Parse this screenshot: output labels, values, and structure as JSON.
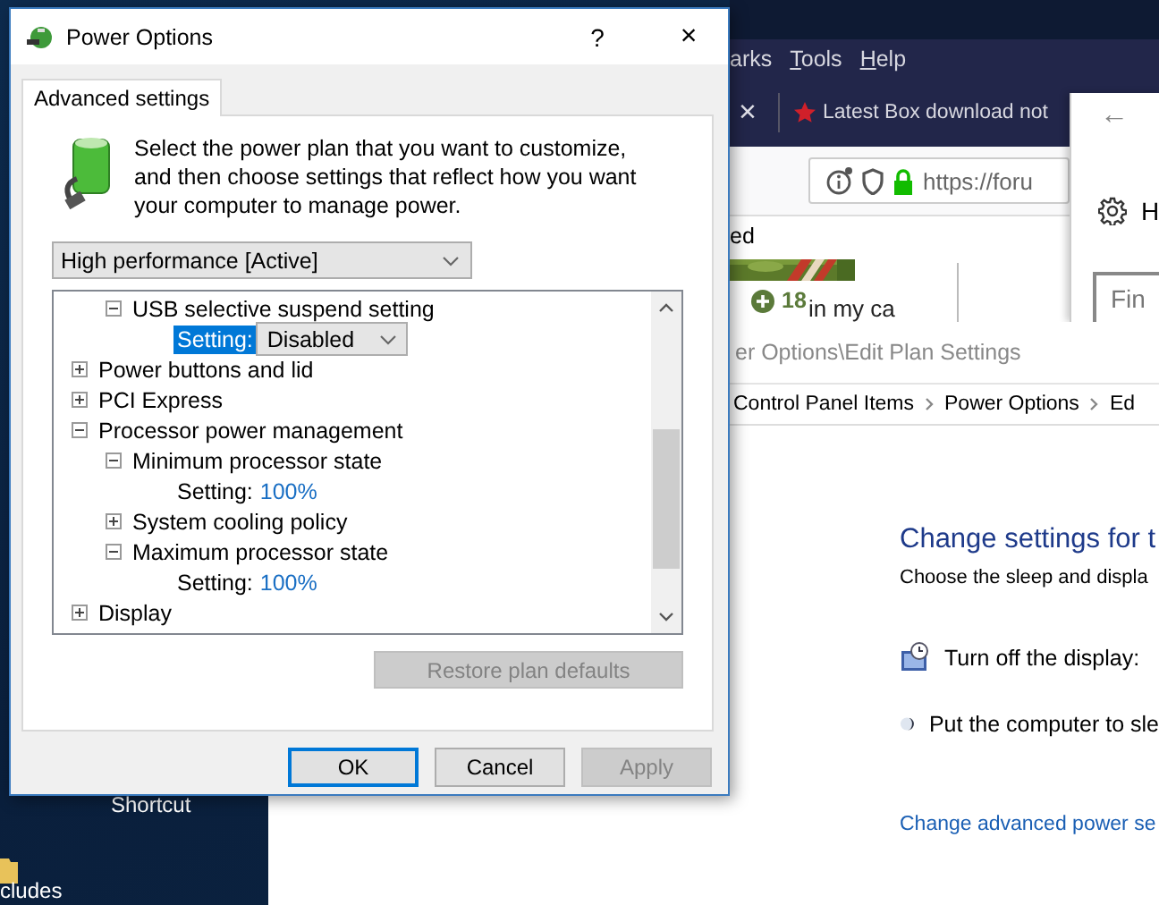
{
  "desktop": {
    "shortcut_label": "Shortcut",
    "folder_label": "cludes"
  },
  "browser": {
    "menu": [
      {
        "label": "arks",
        "underline_first": false
      },
      {
        "label": "Tools",
        "underline_first": true
      },
      {
        "label": "Help",
        "underline_first": true
      }
    ],
    "tab_close": "×",
    "tab": {
      "title": "Latest Box download not"
    },
    "url": "https://foru",
    "page": {
      "fragment": "ed",
      "score": "18",
      "post_text": "in my ca"
    }
  },
  "side_window": {
    "back": "←",
    "title": "H",
    "search": {
      "placeholder": "Fin"
    }
  },
  "control_panel": {
    "address": "er Options\\Edit Plan Settings",
    "breadcrumb": [
      {
        "label": "Control Panel Items"
      },
      {
        "label": "Power Options"
      },
      {
        "label": "Ed"
      }
    ],
    "heading": "Change settings for t",
    "subtitle": "Choose the sleep and displa",
    "rows": [
      {
        "kind": "display",
        "label": "Turn off the display:"
      },
      {
        "kind": "sleep",
        "label": "Put the computer to sle"
      }
    ],
    "link": "Change advanced power se"
  },
  "dialog": {
    "title": "Power Options",
    "help": "?",
    "close": "×",
    "tabs": [
      {
        "label": "Advanced settings",
        "selected": true
      }
    ],
    "description": "Select the power plan that you want to customize, and then choose settings that reflect how you want your computer to manage power.",
    "plan": "High performance [Active]",
    "tree": [
      {
        "children": [
          {
            "label": "USB selective suspend setting",
            "expanded": true,
            "setting": {
              "label": "Setting:",
              "selected": true,
              "kind": "dropdown",
              "value": "Disabled"
            }
          }
        ]
      },
      {
        "label": "Power buttons and lid",
        "expanded": false
      },
      {
        "label": "PCI Express",
        "expanded": false
      },
      {
        "label": "Processor power management",
        "expanded": true,
        "children": [
          {
            "label": "Minimum processor state",
            "expanded": true,
            "setting": {
              "label": "Setting:",
              "selected": false,
              "kind": "text",
              "value": "100%"
            }
          },
          {
            "label": "System cooling policy",
            "expanded": false
          },
          {
            "label": "Maximum processor state",
            "expanded": true,
            "setting": {
              "label": "Setting:",
              "selected": false,
              "kind": "text",
              "value": "100%"
            }
          }
        ]
      },
      {
        "label": "Display",
        "expanded": false
      }
    ],
    "restore": {
      "label": "Restore plan defaults",
      "disabled": true
    },
    "buttons": [
      {
        "label": "OK",
        "default": true,
        "disabled": false
      },
      {
        "label": "Cancel",
        "default": false,
        "disabled": false
      },
      {
        "label": "Apply",
        "default": false,
        "disabled": true
      }
    ]
  }
}
